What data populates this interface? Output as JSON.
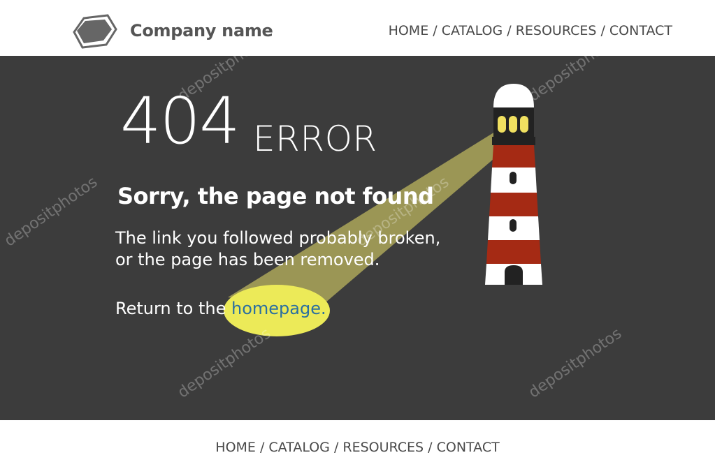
{
  "header": {
    "company_name": "Company name",
    "logo_icon": "hexagon-logo-icon",
    "nav": [
      {
        "label": "HOME"
      },
      {
        "label": "CATALOG"
      },
      {
        "label": "RESOURCES"
      },
      {
        "label": "CONTACT"
      }
    ],
    "separator": " / "
  },
  "main": {
    "code": "404",
    "error_word": "ERROR",
    "headline": "Sorry, the page not found",
    "desc_line1": "The link you followed probably broken,",
    "desc_line2": "or the page has been removed.",
    "return_prefix": "Return to the ",
    "homepage_link": "homepage.",
    "illustration": "lighthouse-icon",
    "colors": {
      "background": "#3c3c3c",
      "beam": "#e9e06a",
      "link": "#2a6fa0",
      "lighthouse_red": "#a52a14"
    }
  },
  "footer": {
    "nav": [
      {
        "label": "HOME"
      },
      {
        "label": "CATALOG"
      },
      {
        "label": "RESOURCES"
      },
      {
        "label": "CONTACT"
      }
    ],
    "separator": " / "
  },
  "watermark": "depositphotos"
}
